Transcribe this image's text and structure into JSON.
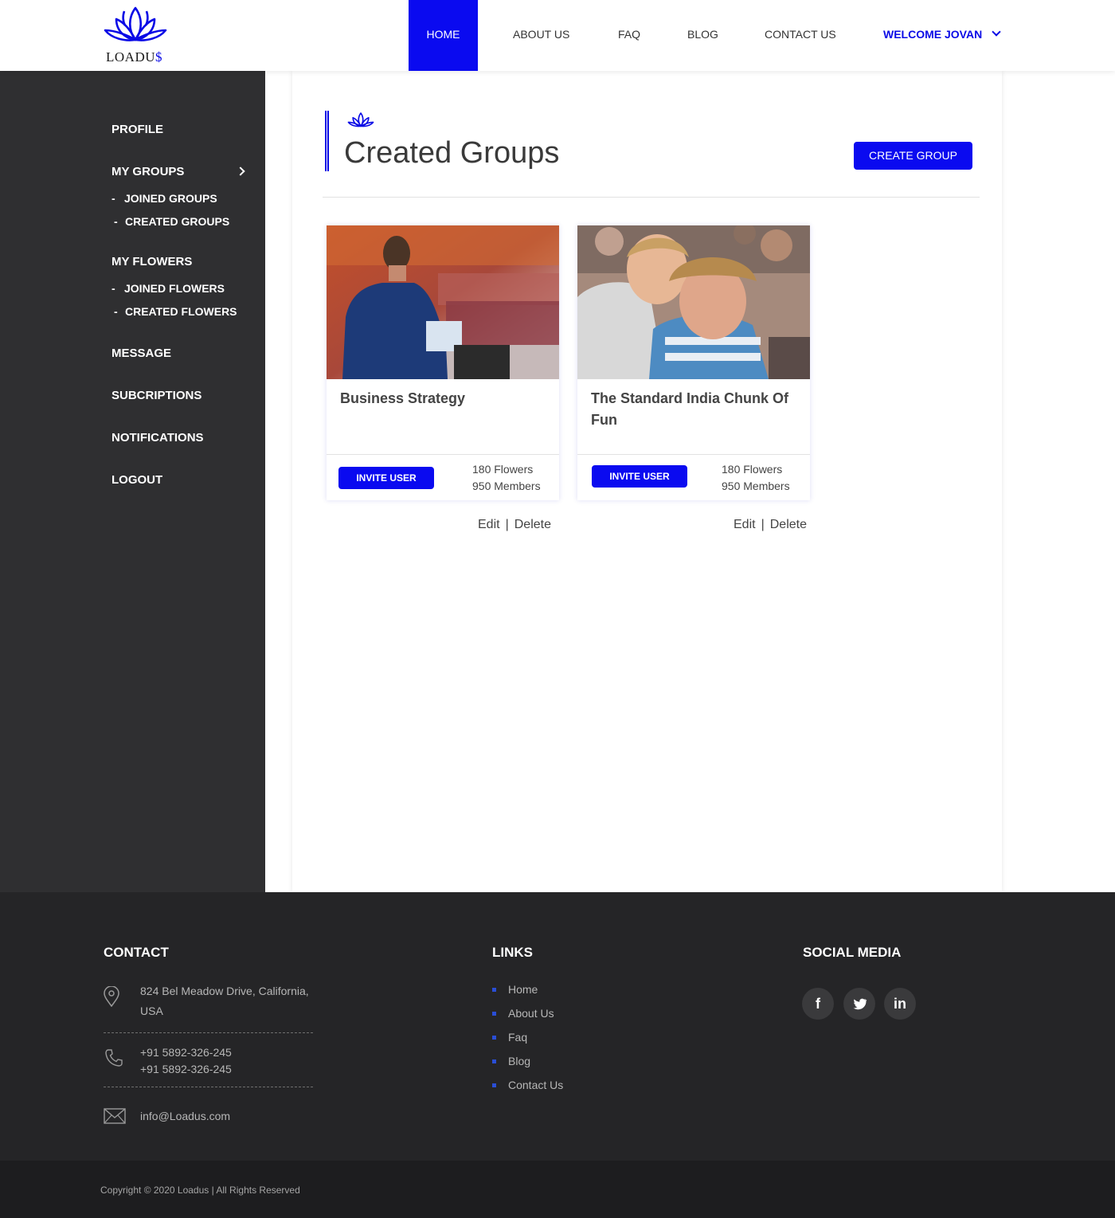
{
  "brand": {
    "logo_text_main": "LOADU",
    "logo_text_accent": "$"
  },
  "nav": {
    "items": [
      {
        "label": "HOME",
        "active": true
      },
      {
        "label": "ABOUT US"
      },
      {
        "label": "FAQ"
      },
      {
        "label": "BLOG"
      },
      {
        "label": "CONTACT US"
      }
    ],
    "welcome": "WELCOME JOVAN"
  },
  "sidebar": {
    "profile": "PROFILE",
    "my_groups": "MY GROUPS",
    "joined_groups": "JOINED GROUPS",
    "created_groups": "CREATED GROUPS",
    "my_flowers": "MY FLOWERS",
    "joined_flowers": "JOINED FLOWERS",
    "created_flowers": "CREATED FLOWERS",
    "message": "MESSAGE",
    "subscriptions": "SUBCRIPTIONS",
    "notifications": "NOTIFICATIONS",
    "logout": "LOGOUT"
  },
  "main": {
    "title": "Created Groups",
    "create_button": "CREATE GROUP",
    "cards": [
      {
        "title": "Business Strategy",
        "invite": "INVITE USER",
        "flowers": "180 Flowers",
        "members": "950 Members",
        "edit": "Edit",
        "delete": "Delete",
        "separator": "|"
      },
      {
        "title": "The Standard India Chunk Of Fun",
        "invite": "INVITE USER",
        "flowers": "180 Flowers",
        "members": "950 Members",
        "edit": "Edit",
        "delete": "Delete",
        "separator": "|"
      }
    ]
  },
  "footer": {
    "contact": {
      "heading": "CONTACT",
      "address": "824 Bel Meadow Drive, California, USA",
      "phone1": "+91 5892-326-245",
      "phone2": "+91 5892-326-245",
      "email": "info@Loadus.com"
    },
    "links": {
      "heading": "LINKS",
      "items": [
        "Home",
        "About Us",
        "Faq",
        "Blog",
        "Contact Us"
      ]
    },
    "social": {
      "heading": "SOCIAL MEDIA",
      "facebook": "f",
      "linkedin": "in"
    },
    "copyright": "Copyright © 2020 Loadus | All Rights Reserved"
  },
  "colors": {
    "accent": "#0a0af0",
    "sidebar_bg": "#2f2f31",
    "footer_bg": "#252527",
    "copyright_bg": "#1d1d1f"
  },
  "icons": {
    "logo": "lotus-icon",
    "dropdown": "chevron-down-icon",
    "submenu": "chevron-right-icon",
    "address": "map-pin-icon",
    "phone": "phone-icon",
    "email": "mail-icon",
    "social": [
      "facebook-icon",
      "twitter-icon",
      "linkedin-icon"
    ]
  }
}
